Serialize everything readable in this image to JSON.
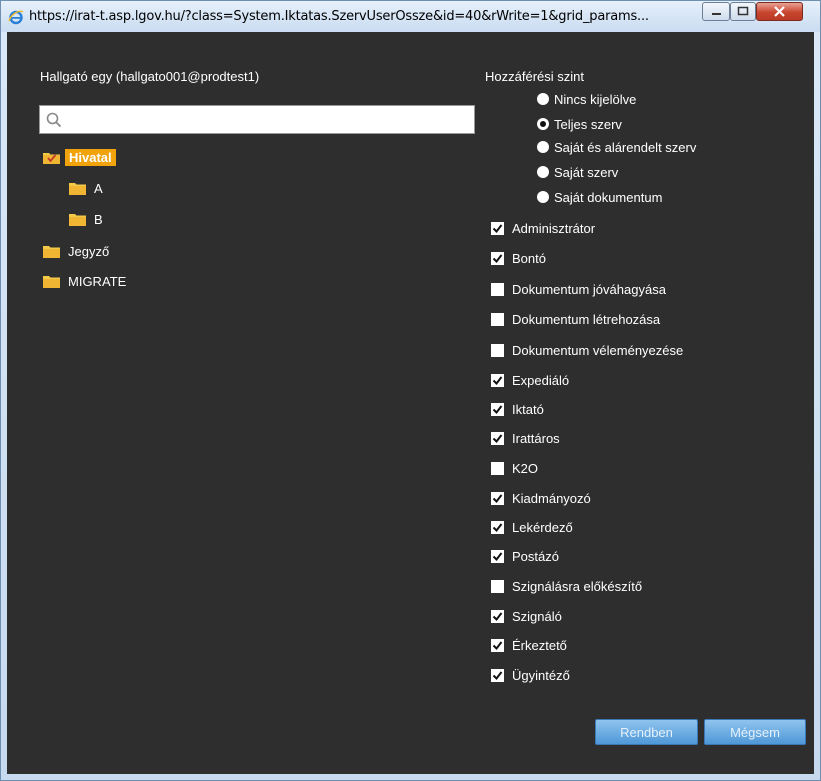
{
  "window": {
    "title": "https://irat-t.asp.lgov.hu/?class=System.Iktatas.SzervUserOssze&id=40&rWrite=1&grid_params..."
  },
  "user_label": "Hallgató egy (hallgato001@prodtest1)",
  "search": {
    "placeholder": ""
  },
  "tree": [
    {
      "label": "Hivatal",
      "selected": true,
      "level": 0
    },
    {
      "label": "A",
      "selected": false,
      "level": 1
    },
    {
      "label": "B",
      "selected": false,
      "level": 1
    },
    {
      "label": "Jegyző",
      "selected": false,
      "level": 0
    },
    {
      "label": "MIGRATE",
      "selected": false,
      "level": 0
    }
  ],
  "access_level": {
    "title": "Hozzáférési szint",
    "options": [
      {
        "label": "Nincs kijelölve",
        "selected": false
      },
      {
        "label": "Teljes szerv",
        "selected": true
      },
      {
        "label": "Saját és alárendelt szerv",
        "selected": false
      },
      {
        "label": "Saját szerv",
        "selected": false
      },
      {
        "label": "Saját dokumentum",
        "selected": false
      }
    ]
  },
  "roles": [
    {
      "label": "Adminisztrátor",
      "checked": true
    },
    {
      "label": "Bontó",
      "checked": true
    },
    {
      "label": "Dokumentum jóváhagyása",
      "checked": false
    },
    {
      "label": "Dokumentum létrehozása",
      "checked": false
    },
    {
      "label": "Dokumentum véleményezése",
      "checked": false
    },
    {
      "label": "Expediáló",
      "checked": true
    },
    {
      "label": "Iktató",
      "checked": true
    },
    {
      "label": "Irattáros",
      "checked": true
    },
    {
      "label": "K2O",
      "checked": false
    },
    {
      "label": "Kiadmányozó",
      "checked": true
    },
    {
      "label": "Lekérdező",
      "checked": true
    },
    {
      "label": "Postázó",
      "checked": true
    },
    {
      "label": "Szignálásra előkészítő",
      "checked": false
    },
    {
      "label": "Szignáló",
      "checked": true
    },
    {
      "label": "Érkeztető",
      "checked": true
    },
    {
      "label": "Ügyintéző",
      "checked": true
    }
  ],
  "buttons": {
    "ok": "Rendben",
    "cancel": "Mégsem"
  },
  "colors": {
    "background": "#2e2e2e",
    "selected": "#f0a30a",
    "button": "#5fa6e0"
  }
}
